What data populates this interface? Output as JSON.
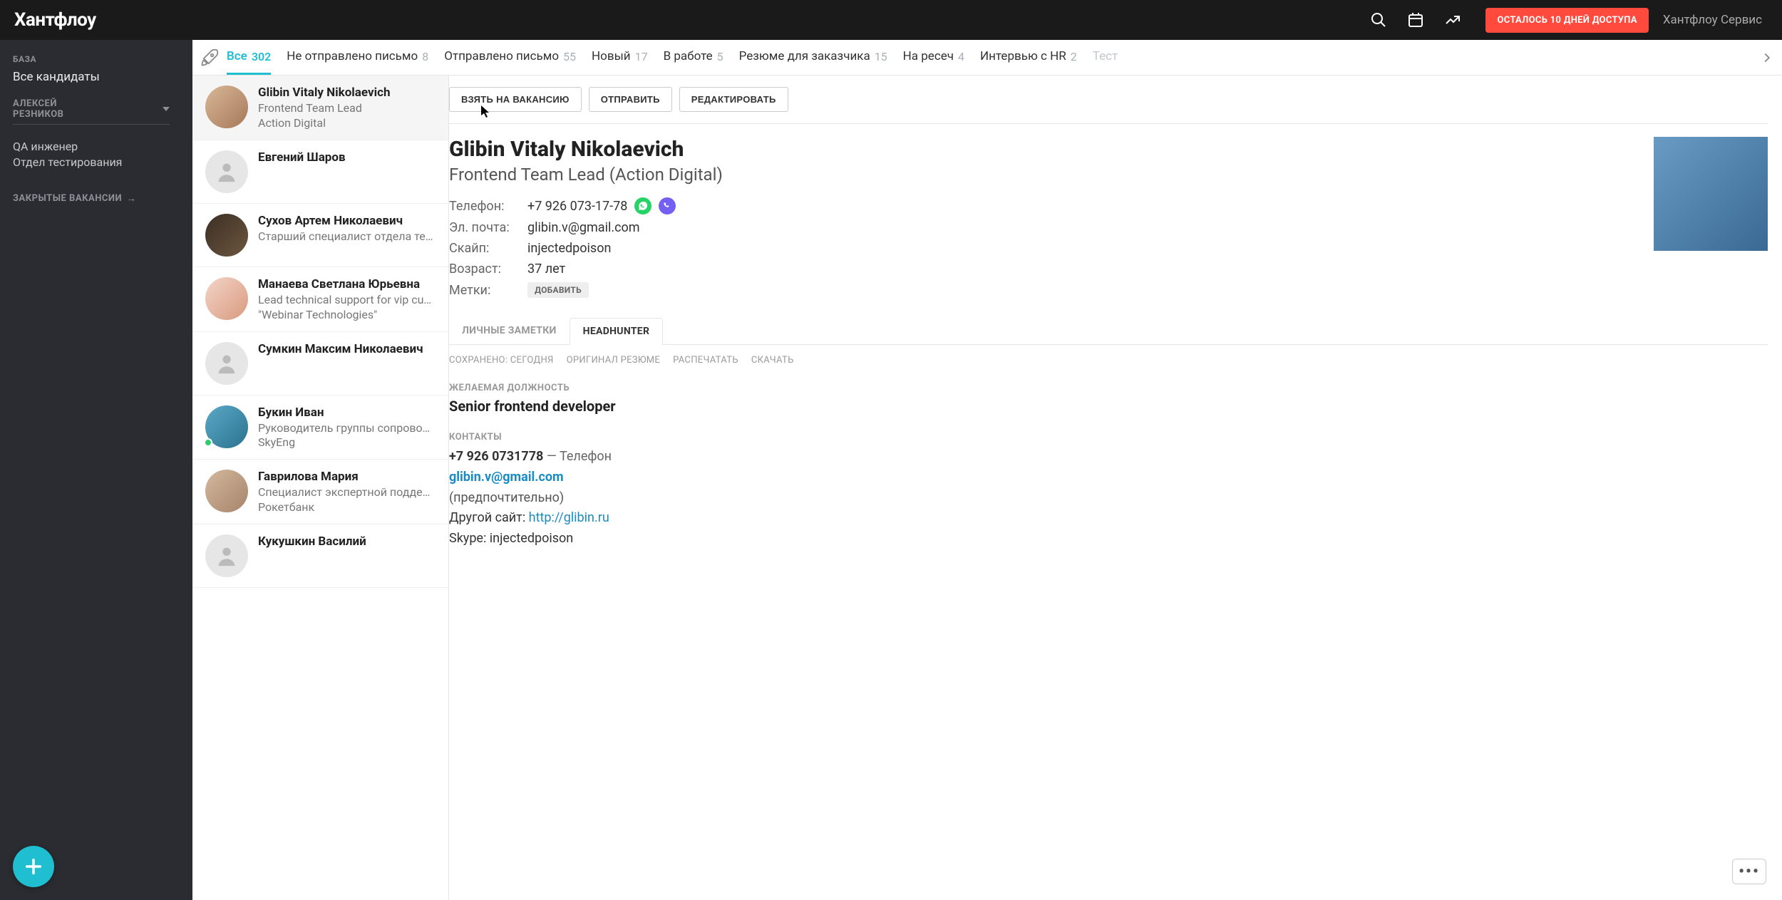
{
  "header": {
    "logo": "Хантфлоу",
    "trial_button": "ОСТАЛОСЬ 10 ДНЕЙ ДОСТУПА",
    "service_label": "Хантфлоу Сервис"
  },
  "sidebar": {
    "base_label": "БАЗА",
    "all_candidates": "Все кандидаты",
    "user_name": "АЛЕКСЕЙ РЕЗНИКОВ",
    "vacancies": [
      "QA инженер",
      "Отдел тестирования"
    ],
    "closed_label": "ЗАКРЫТЫЕ ВАКАНСИИ"
  },
  "status_tabs": [
    {
      "label": "Все",
      "count": "302",
      "active": true
    },
    {
      "label": "Не отправлено письмо",
      "count": "8"
    },
    {
      "label": "Отправлено письмо",
      "count": "55"
    },
    {
      "label": "Новый",
      "count": "17"
    },
    {
      "label": "В работе",
      "count": "5"
    },
    {
      "label": "Резюме для заказчика",
      "count": "15"
    },
    {
      "label": "На ресеч",
      "count": "4"
    },
    {
      "label": "Интервью с HR",
      "count": "2"
    },
    {
      "label": "Тест",
      "count": "",
      "faded": true
    }
  ],
  "candidates": [
    {
      "name": "Glibin Vitaly Nikolaevich",
      "position": "Frontend Team Lead",
      "company": "Action Digital",
      "avatar": "photo1",
      "selected": true
    },
    {
      "name": "Евгений Шаров",
      "position": "",
      "company": "",
      "avatar": ""
    },
    {
      "name": "Сухов Артем Николаевич",
      "position": "Старший специалист отдела те…",
      "company": "",
      "avatar": "photo3"
    },
    {
      "name": "Манаева Светлана Юрьевна",
      "position": "Lead technical support for vip cu…",
      "company": "\"Webinar Technologies\"",
      "avatar": "photo4"
    },
    {
      "name": "Сумкин Максим Николаевич",
      "position": "",
      "company": "",
      "avatar": ""
    },
    {
      "name": "Букин Иван",
      "position": "Руководитель группы сопровож…",
      "company": "SkyEng",
      "avatar": "photo6",
      "online": true
    },
    {
      "name": "Гаврилова Мария",
      "position": "Специалист экспертной подде…",
      "company": "Рокетбанк",
      "avatar": "photo7"
    },
    {
      "name": "Кукушкин Василий",
      "position": "",
      "company": "",
      "avatar": ""
    }
  ],
  "detail": {
    "actions": {
      "take": "ВЗЯТЬ НА ВАКАНСИЮ",
      "send": "ОТПРАВИТЬ",
      "edit": "РЕДАКТИРОВАТЬ"
    },
    "name": "Glibin Vitaly Nikolaevich",
    "title": "Frontend Team Lead (Action Digital)",
    "fields": {
      "phone_label": "Телефон:",
      "phone_value": "+7 926 073-17-78",
      "email_label": "Эл. почта:",
      "email_value": "glibin.v@gmail.com",
      "skype_label": "Скайп:",
      "skype_value": "injectedpoison",
      "age_label": "Возраст:",
      "age_value": "37 лет",
      "tags_label": "Метки:",
      "tags_add": "ДОБАВИТЬ"
    },
    "source_tabs": {
      "personal": "ЛИЧНЫЕ ЗАМЕТКИ",
      "hh": "HEADHUNTER"
    },
    "meta": {
      "saved": "СОХРАНЕНО: СЕГОДНЯ",
      "original": "ОРИГИНАЛ РЕЗЮМЕ",
      "print": "РАСПЕЧАТАТЬ",
      "download": "СКАЧАТЬ"
    },
    "desired_label": "ЖЕЛАЕМАЯ ДОЛЖНОСТЬ",
    "desired_value": "Senior frontend developer",
    "contacts_label": "КОНТАКТЫ",
    "contacts": {
      "phone": "+7 926 0731778",
      "phone_suffix": " — Телефон",
      "email": "glibin.v@gmail.com",
      "preferred": "(предпочтительно)",
      "other_site_label": "Другой сайт: ",
      "other_site": "http://glibin.ru",
      "skype_line": "Skype: injectedpoison"
    }
  },
  "chat_dots": "•••"
}
